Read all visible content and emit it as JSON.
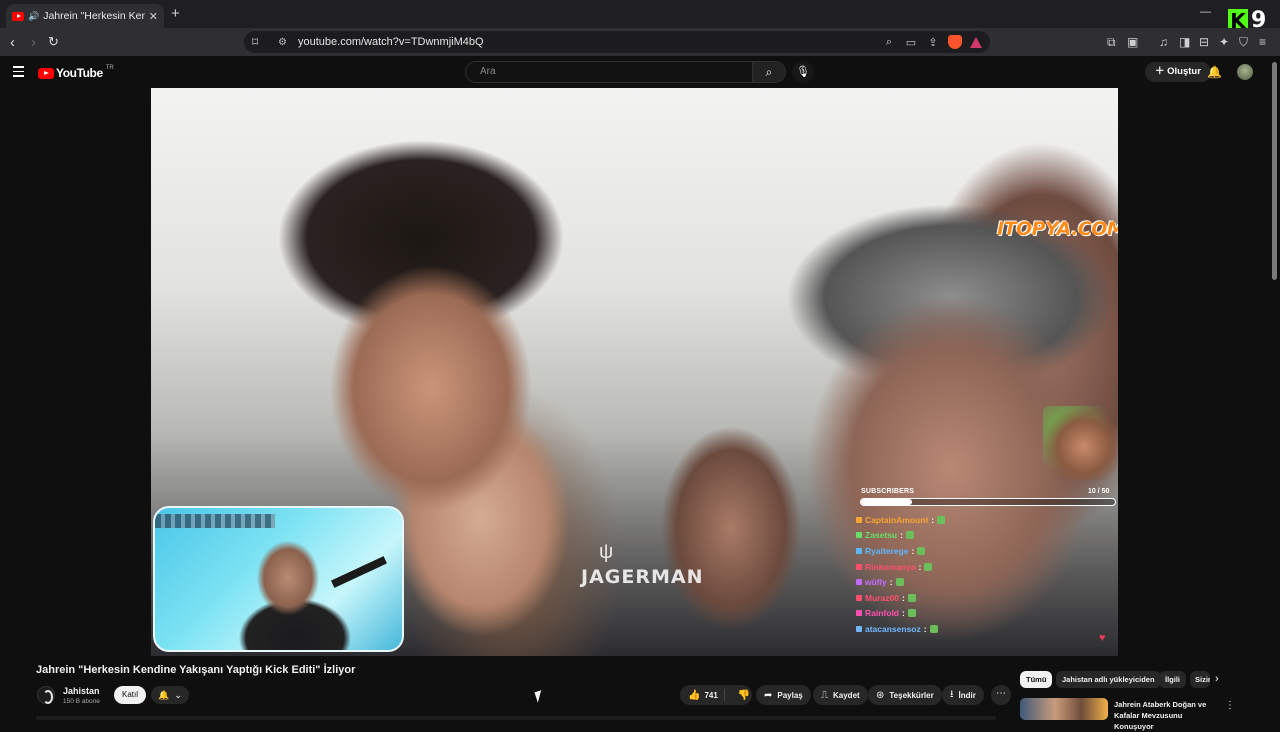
{
  "browser": {
    "tab_title": "Jahrein \"Herkesin Kendine Yakışanı Yaptığı Kick Editi\" İzliyor",
    "url": "youtube.com/watch?v=TDwnmjiM4bQ",
    "minimize_glyph": "—",
    "overlay_logo_letter": "K",
    "overlay_logo_number": "9"
  },
  "youtube": {
    "logo_text": "YouTube",
    "logo_region": "TR",
    "search_placeholder": "Ara",
    "create_label": "Oluştur"
  },
  "video": {
    "title": "Jahrein \"Herkesin Kendine Yakışanı Yaptığı Kick Editi\" İzliyor",
    "watermark_itopya": "ITOPYA.COM",
    "watermark_jager": "JAGERMAN",
    "subscribers_label": "SUBSCRIBERS",
    "subscribers_count": "10 / 50",
    "subscribers_progress": 0.2,
    "chat": [
      {
        "name": "CaptainAmount",
        "color": "#f7a531"
      },
      {
        "name": "Zasetsu",
        "color": "#66e066"
      },
      {
        "name": "Ryalterege",
        "color": "#5db7ff"
      },
      {
        "name": "Rinkomanya",
        "color": "#ff4f6d"
      },
      {
        "name": "wüfly",
        "color": "#c46bff"
      },
      {
        "name": "Muraz00",
        "color": "#ff4f6d"
      },
      {
        "name": "Rainfold",
        "color": "#ff4fb1"
      },
      {
        "name": "atacansensoz",
        "color": "#6fb6ff"
      }
    ]
  },
  "channel": {
    "name": "Jahistan",
    "subscribers": "150 B abone",
    "join_label": "Katıl"
  },
  "actions": {
    "likes": "741",
    "share": "Paylaş",
    "save": "Kaydet",
    "thanks": "Teşekkürler",
    "download": "İndir"
  },
  "chips": [
    "Tümü",
    "Jahistan adlı yükleyiciden",
    "İlgili",
    "Sizin için"
  ],
  "recommendation": {
    "title": "Jahrein Ataberk Doğan ve Kafalar Mevzusunu Konuşuyor"
  }
}
